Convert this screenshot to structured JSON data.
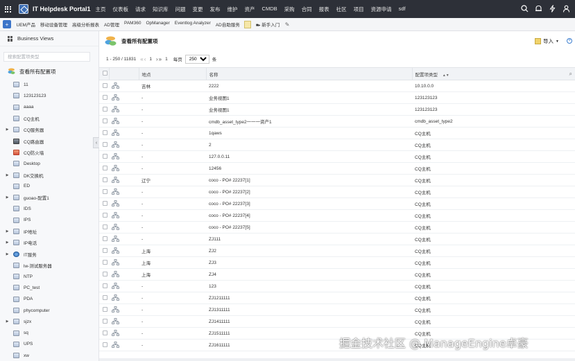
{
  "app": {
    "title": "IT Helpdesk Portal1",
    "nav": [
      "主页",
      "仪表板",
      "请求",
      "知识库",
      "问题",
      "变更",
      "发布",
      "维护",
      "资产",
      "CMDB",
      "采购",
      "合同",
      "报表",
      "社区",
      "项目",
      "资源申请",
      "sdf"
    ],
    "right_icons": [
      "search-icon",
      "bell-icon",
      "lightning-icon",
      "user-icon"
    ]
  },
  "toolbar": {
    "items": [
      "UEM产品",
      "移动设备管理",
      "高级分析报表",
      "AD管理",
      "PAM360",
      "OpManager",
      "Eventlog Analyzer",
      "AD自助服务"
    ],
    "guide": "新手入门"
  },
  "sidebar": {
    "title": "Business Views",
    "search_placeholder": "搜索配置项类型",
    "all_label": "查看所有配置项",
    "items": [
      {
        "label": "11",
        "expandable": false,
        "icon": "server"
      },
      {
        "label": "123123123",
        "expandable": false,
        "icon": "server"
      },
      {
        "label": "aaaa",
        "expandable": false,
        "icon": "server"
      },
      {
        "label": "CQ主机",
        "expandable": false,
        "icon": "server"
      },
      {
        "label": "CQ服务器",
        "expandable": true,
        "icon": "server"
      },
      {
        "label": "CQ路由器",
        "expandable": false,
        "icon": "router"
      },
      {
        "label": "CQ防火墙",
        "expandable": false,
        "icon": "firewall"
      },
      {
        "label": "Desktop",
        "expandable": false,
        "icon": "server"
      },
      {
        "label": "DK交换机",
        "expandable": true,
        "icon": "server"
      },
      {
        "label": "ED",
        "expandable": false,
        "icon": "server"
      },
      {
        "label": "guoao-配置1",
        "expandable": true,
        "icon": "server"
      },
      {
        "label": "IDS",
        "expandable": false,
        "icon": "server"
      },
      {
        "label": "IPS",
        "expandable": false,
        "icon": "server"
      },
      {
        "label": "IP地址",
        "expandable": true,
        "icon": "server"
      },
      {
        "label": "IP电话",
        "expandable": true,
        "icon": "server"
      },
      {
        "label": "IT服务",
        "expandable": true,
        "icon": "globe"
      },
      {
        "label": "lw-测试服务器",
        "expandable": false,
        "icon": "server"
      },
      {
        "label": "NTP",
        "expandable": false,
        "icon": "server"
      },
      {
        "label": "PC_test",
        "expandable": false,
        "icon": "server"
      },
      {
        "label": "PDA",
        "expandable": false,
        "icon": "server"
      },
      {
        "label": "phycomputer",
        "expandable": false,
        "icon": "server"
      },
      {
        "label": "sjzx",
        "expandable": true,
        "icon": "server"
      },
      {
        "label": "sq",
        "expandable": false,
        "icon": "server"
      },
      {
        "label": "UPS",
        "expandable": false,
        "icon": "server"
      },
      {
        "label": "xw",
        "expandable": false,
        "icon": "server"
      }
    ]
  },
  "main": {
    "title": "查看所有配置项",
    "import_label": "导入",
    "pager": {
      "range": "1 - 250 / 11831",
      "page": "1",
      "per_page_label": "每页",
      "per_page_value": "250",
      "unit": "条"
    },
    "columns": [
      "地点",
      "名称",
      "配置项类型"
    ],
    "rows": [
      [
        "吉林",
        "2222",
        "10.10.0.0"
      ],
      [
        "-",
        "业务视图1",
        "123123123"
      ],
      [
        "-",
        "业务视图1",
        "123123123"
      ],
      [
        "-",
        "cmdb_asset_type2一一一资产1",
        "cmdb_asset_type2"
      ],
      [
        "-",
        "1qaws",
        "CQ主机"
      ],
      [
        "-",
        "2",
        "CQ主机"
      ],
      [
        "-",
        "127.0.0.11",
        "CQ主机"
      ],
      [
        "-",
        "12456",
        "CQ主机"
      ],
      [
        "辽宁",
        "coco - PO# 22237[1]",
        "CQ主机"
      ],
      [
        "-",
        "coco - PO# 22237[2]",
        "CQ主机"
      ],
      [
        "-",
        "coco - PO# 22237[3]",
        "CQ主机"
      ],
      [
        "-",
        "coco - PO# 22237[4]",
        "CQ主机"
      ],
      [
        "-",
        "coco - PO# 22237[5]",
        "CQ主机"
      ],
      [
        "-",
        "ZJ111",
        "CQ主机"
      ],
      [
        "上海",
        "ZJ2",
        "CQ主机"
      ],
      [
        "上海",
        "ZJ3",
        "CQ主机"
      ],
      [
        "上海",
        "ZJ4",
        "CQ主机"
      ],
      [
        "-",
        "123",
        "CQ主机"
      ],
      [
        "-",
        "ZJ1211111",
        "CQ主机"
      ],
      [
        "-",
        "ZJ1311111",
        "CQ主机"
      ],
      [
        "-",
        "ZJ1411111",
        "CQ主机"
      ],
      [
        "-",
        "ZJ1511111",
        "CQ主机"
      ],
      [
        "-",
        "ZJ1611111",
        "CQ主机"
      ]
    ]
  },
  "watermark": "掘金技术社区 @ ManageEngine卓豪",
  "colors": {
    "topbar": "#2d3038",
    "accent": "#3b74c9"
  }
}
